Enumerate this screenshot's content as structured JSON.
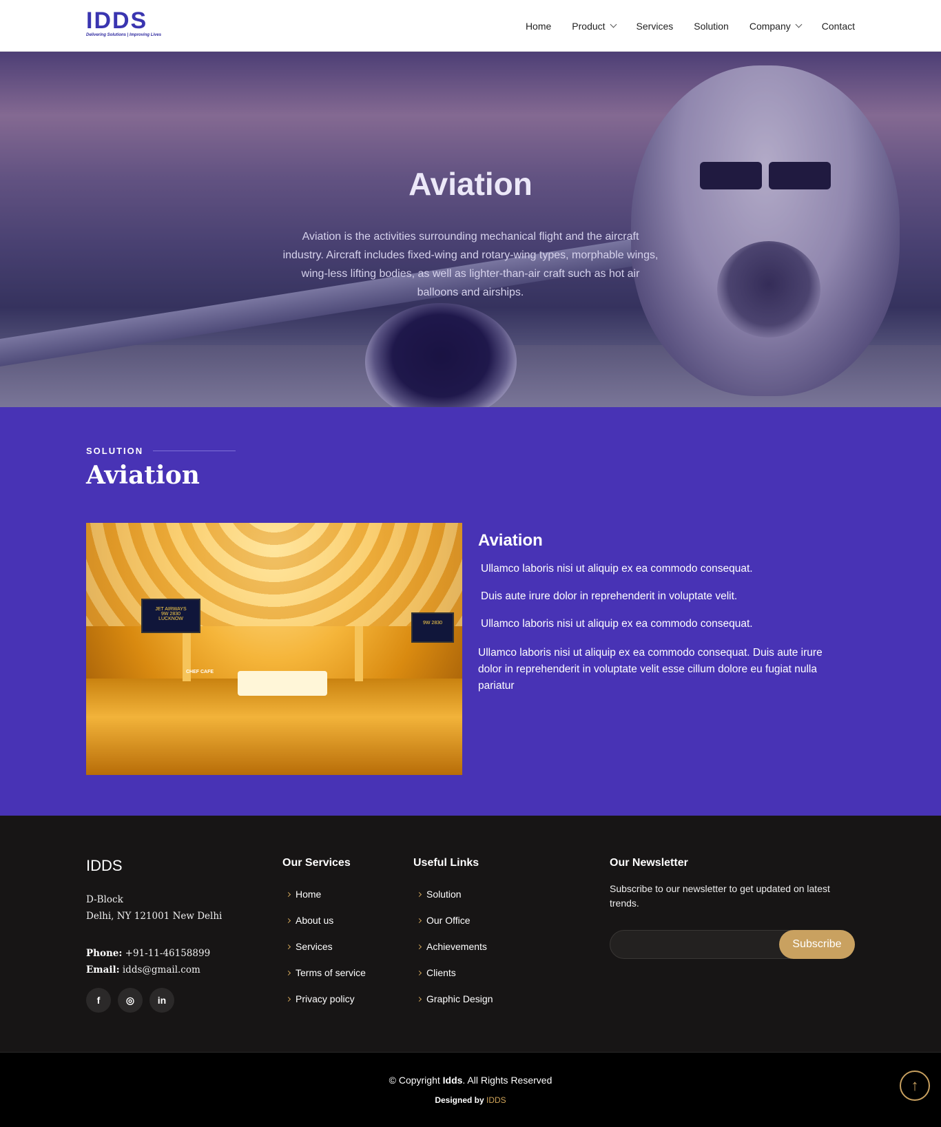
{
  "header": {
    "logo_text": "IDDS",
    "logo_tagline": "Delivering Solutions | Improving Lives",
    "nav": [
      {
        "label": "Home"
      },
      {
        "label": "Product"
      },
      {
        "label": "Services"
      },
      {
        "label": "Solution"
      },
      {
        "label": "Company"
      },
      {
        "label": "Contact"
      }
    ]
  },
  "hero": {
    "title": "Aviation",
    "text": "Aviation is the activities surrounding mechanical flight and the aircraft industry. Aircraft includes fixed-wing and rotary-wing types, morphable wings, wing-less lifting bodies, as well as lighter-than-air craft such as hot air balloons and airships."
  },
  "solution": {
    "label": "SOLUTION",
    "title": "Aviation",
    "subtitle": "Aviation",
    "bullets": [
      "Ullamco laboris nisi ut aliquip ex ea commodo consequat.",
      "Duis aute irure dolor in reprehenderit in voluptate velit.",
      "Ullamco laboris nisi ut aliquip ex ea commodo consequat."
    ],
    "paragraph": "Ullamco laboris nisi ut aliquip ex ea commodo consequat. Duis aute irure dolor in reprehenderit in voluptate velit esse cillum dolore eu fugiat nulla pariatur",
    "image_screen_flight": "9W 2830",
    "image_screen_city": "LUCKNOW",
    "image_screen_airline": "JET AIRWAYS",
    "image_cafe": "CHEF CAFE"
  },
  "footer": {
    "brand": "IDDS",
    "address_line1": "D-Block",
    "address_line2": "Delhi, NY 121001 New Delhi",
    "phone_label": "Phone:",
    "phone": "+91-11-46158899",
    "email_label": "Email:",
    "email": "idds@gmail.com",
    "socials": [
      {
        "icon": "facebook-icon",
        "glyph": "f"
      },
      {
        "icon": "instagram-icon",
        "glyph": "◎"
      },
      {
        "icon": "linkedin-icon",
        "glyph": "in"
      }
    ],
    "services": {
      "title": "Our Services",
      "links": [
        "Home",
        "About us",
        "Services",
        "Terms of service",
        "Privacy policy"
      ]
    },
    "useful": {
      "title": "Useful Links",
      "links": [
        "Solution",
        "Our Office",
        "Achievements",
        "Clients",
        "Graphic Design"
      ]
    },
    "newsletter": {
      "title": "Our Newsletter",
      "text": "Subscribe to our newsletter to get updated on latest trends.",
      "input_value": "",
      "button": "Subscribe"
    }
  },
  "bottom": {
    "copy_prefix": "© Copyright ",
    "copy_brand": "Idds",
    "copy_suffix": ". All Rights Reserved",
    "designed_prefix": "Designed by ",
    "designed_brand": "IDDS"
  },
  "colors": {
    "accent": "#4833b5",
    "gold": "#c9a160",
    "footer_bg": "#171515"
  }
}
